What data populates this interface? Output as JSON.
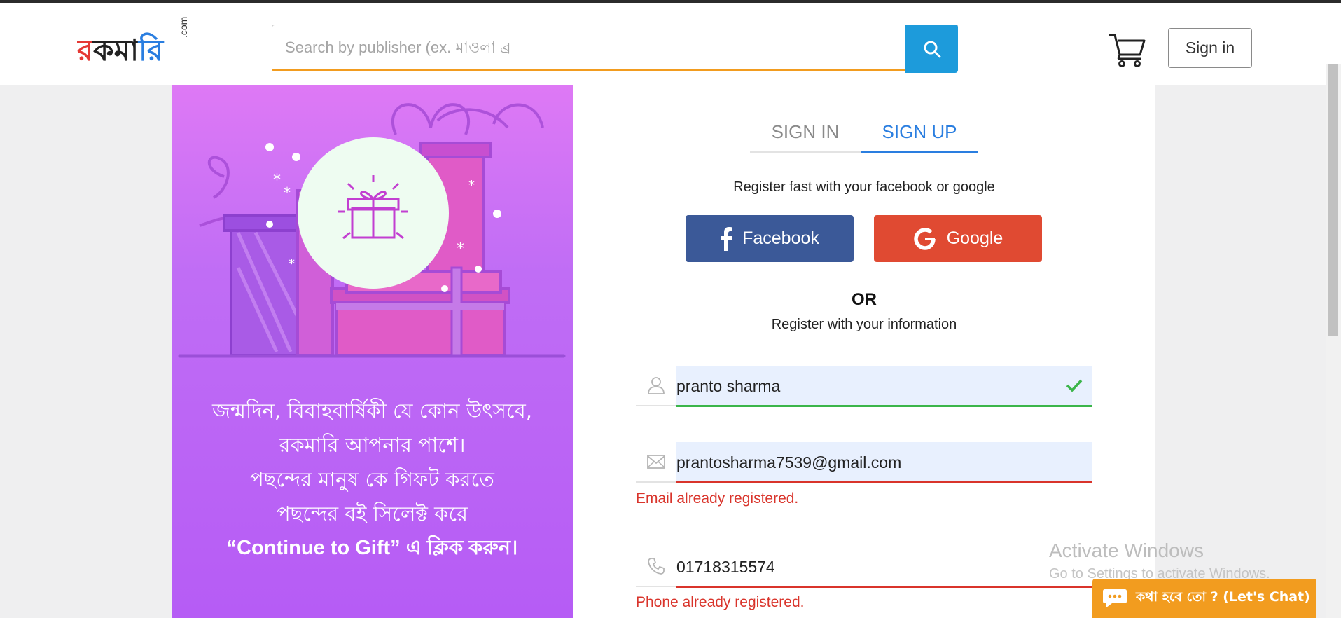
{
  "header": {
    "logo_text": "রকমারি",
    "logo_suffix": ".com",
    "search_placeholder": "Search by publisher (ex. মাওলা ব্র",
    "signin_label": "Sign in"
  },
  "promo": {
    "lines": [
      "জন্মদিন, বিবাহবার্ষিকী যে কোন উৎসবে,",
      "রকমারি আপনার পাশে।",
      "পছন্দের মানুষ কে গিফট করতে",
      "পছন্দের বই সিলেক্ট করে",
      "“Continue to Gift” এ ক্লিক করুন।"
    ]
  },
  "form": {
    "tabs": {
      "signin": "SIGN IN",
      "signup": "SIGN UP"
    },
    "social_title": "Register fast with your facebook or google",
    "facebook_label": "Facebook",
    "google_label": "Google",
    "or_label": "OR",
    "info_title": "Register with your information",
    "name_value": "pranto sharma",
    "email_value": "prantosharma7539@gmail.com",
    "email_error": "Email already registered.",
    "phone_value": "01718315574",
    "phone_error": "Phone already registered."
  },
  "overlay": {
    "activate_title": "Activate Windows",
    "activate_sub": "Go to Settings to activate Windows.",
    "chat_label": "কথা হবে তো ? (Let's Chat)"
  },
  "colors": {
    "search_accent": "#f29c1f",
    "search_button": "#1d9bdb",
    "tab_active": "#2a7ee0",
    "facebook": "#3b5998",
    "google": "#e04a32",
    "valid": "#3bb54a",
    "error": "#d9342b",
    "promo_top": "#de79f5",
    "promo_bottom": "#b65cf5"
  },
  "icons": [
    "search-icon",
    "cart-icon",
    "gift-icon",
    "user-icon",
    "mail-icon",
    "phone-icon",
    "check-icon",
    "facebook-icon",
    "google-icon",
    "chat-icon"
  ]
}
